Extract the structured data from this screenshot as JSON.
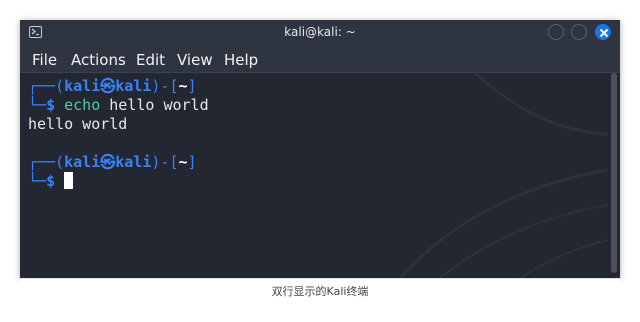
{
  "window": {
    "title": "kali@kali: ~",
    "icon": "terminal-icon"
  },
  "menu": {
    "file": "File",
    "actions": "Actions",
    "edit": "Edit",
    "view": "View",
    "help": "Help"
  },
  "terminal": {
    "prompt1": {
      "box_top": "┌──",
      "open_paren": "(",
      "user": "kali",
      "skull": "㉿",
      "host": "kali",
      "close_paren": ")",
      "dash": "-",
      "open_bracket": "[",
      "dir": "~",
      "close_bracket": "]",
      "box_bottom": "└─",
      "dollar": "$",
      "command": "echo",
      "args": "hello world"
    },
    "output": "hello world",
    "prompt2": {
      "box_top": "┌──",
      "open_paren": "(",
      "user": "kali",
      "skull": "㉿",
      "host": "kali",
      "close_paren": ")",
      "dash": "-",
      "open_bracket": "[",
      "dir": "~",
      "close_bracket": "]",
      "box_bottom": "└─",
      "dollar": "$"
    }
  },
  "caption": "双行显示的Kali终端",
  "colors": {
    "background": "#232731",
    "prompt_blue": "#3a83f7",
    "command": "#4ec9b0",
    "close_button": "#1a73e8"
  }
}
